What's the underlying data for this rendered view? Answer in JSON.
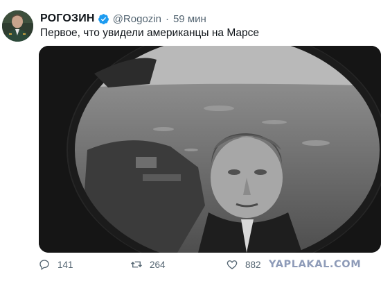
{
  "user": {
    "display_name": "РОГОЗИН",
    "handle": "@Rogozin",
    "separator": "·",
    "time": "59 мин",
    "avatar_icon": "user-avatar"
  },
  "tweet": {
    "text": "Первое, что увидели американцы на Марсе"
  },
  "actions": {
    "reply_count": "141",
    "retweet_count": "264",
    "like_count": "882"
  },
  "watermark": "YAPLAKAL.COM",
  "colors": {
    "verified": "#1d9bf0",
    "secondary_text": "#536471",
    "primary_text": "#0f1419"
  }
}
